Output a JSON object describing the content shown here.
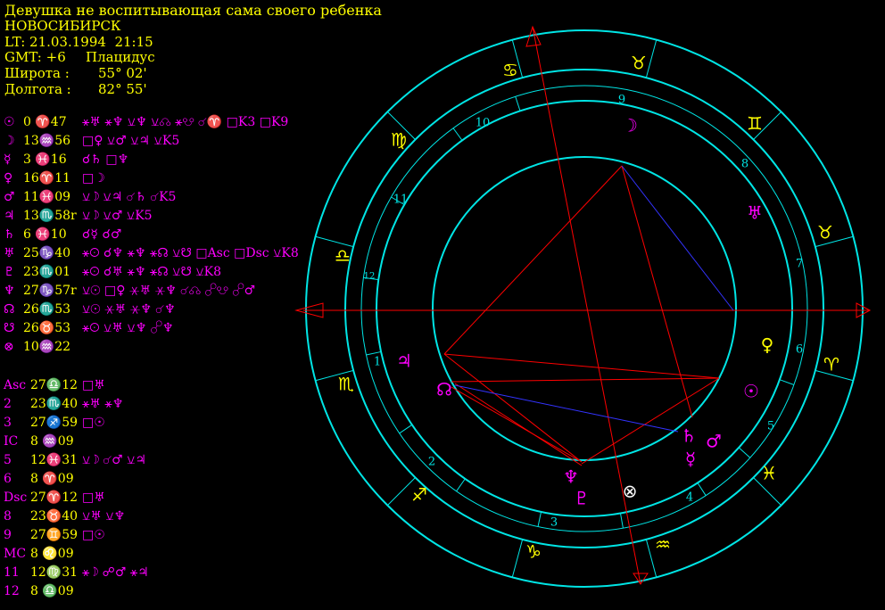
{
  "header": {
    "title": "Девушка не воспитывающая сама своего ребенка",
    "city": "НОВОСИБИРСК",
    "local_time": "LT: 21.03.1994  21:15",
    "gmt": "GMT: +6",
    "house_system": "Плацидус",
    "latitude_label": "Широта :",
    "latitude_value": "55° 02'",
    "longitude_label": "Долгота :",
    "longitude_value": "82° 55'"
  },
  "planets": [
    {
      "glyph": "☉",
      "pos": "0 ♈47",
      "aspects": "⚹♅ ⚹♆ ⚺♆ ⚺☊ ⚹☋ ☌♈ □K3 □K9"
    },
    {
      "glyph": "☽",
      "pos": "13♒56",
      "aspects": "□♀ ⚺♂ ⚺♃ ⚺K5"
    },
    {
      "glyph": "☿",
      "pos": "3 ♓16",
      "aspects": "☌♄ □♆"
    },
    {
      "glyph": "♀",
      "pos": "16♈11",
      "aspects": "□☽"
    },
    {
      "glyph": "♂",
      "pos": "11♓09",
      "aspects": "⚺☽ ⚺♃ ☌♄ ☌K5"
    },
    {
      "glyph": "♃",
      "pos": "13♏58r",
      "aspects": "⚺☽ ⚺♂ ⚺K5"
    },
    {
      "glyph": "♄",
      "pos": "6 ♓10",
      "aspects": "☌☿ ☌♂"
    },
    {
      "glyph": "♅",
      "pos": "25♑40",
      "aspects": "⚹☉ ☌♆ ⚹♆ ⚹☊ ⚺☋ □Asc □Dsc ⚺K8"
    },
    {
      "glyph": "♇",
      "pos": "23♏01",
      "aspects": "⚹☉ ☌♅ ⚹♆ ⚹☊ ⚺☋ ⚺K8"
    },
    {
      "glyph": "♆",
      "pos": "27♑57r",
      "aspects": "⚺☉ □♀ ⚹♅ ⚹♆ ☌☊ ☍☋ ☍♂"
    },
    {
      "glyph": "☊",
      "pos": "26♏53",
      "aspects": "⚺☉ ⚹♅ ⚹♆ ☌♆"
    },
    {
      "glyph": "☋",
      "pos": "26♉53",
      "aspects": "⚹☉ ⚺♅ ⚺♆ ☍♆"
    },
    {
      "glyph": "⊗",
      "pos": "10♒22",
      "aspects": ""
    }
  ],
  "houses": [
    {
      "label": "Asc",
      "pos": "27♎12",
      "aspects": "□♅"
    },
    {
      "label": "2",
      "pos": "23♏40",
      "aspects": "⚹♅ ⚹♆"
    },
    {
      "label": "3",
      "pos": "27♐59",
      "aspects": "□☉"
    },
    {
      "label": "IC",
      "pos": "8 ♒09",
      "aspects": ""
    },
    {
      "label": "5",
      "pos": "12♓31",
      "aspects": "⚺☽ ☌♂ ⚺♃"
    },
    {
      "label": "6",
      "pos": "8 ♈09",
      "aspects": ""
    },
    {
      "label": "Dsc",
      "pos": "27♈12",
      "aspects": "□♅"
    },
    {
      "label": "8",
      "pos": "23♉40",
      "aspects": "⚺♅ ⚺♆"
    },
    {
      "label": "9",
      "pos": "27♊59",
      "aspects": "□☉"
    },
    {
      "label": "MC",
      "pos": "8 ♌09",
      "aspects": ""
    },
    {
      "label": "11",
      "pos": "12♍31",
      "aspects": "⚹☽ ☍♂ ⚹♃"
    },
    {
      "label": "12",
      "pos": "8 ♎09",
      "aspects": ""
    }
  ],
  "wheel": {
    "signs": [
      {
        "glyph": "♋",
        "color": "#ffff00"
      },
      {
        "glyph": "♉",
        "color": "#ffff00"
      },
      {
        "glyph": "♊",
        "color": "#ffff00"
      },
      {
        "glyph": "♉",
        "color": "#ffff00"
      },
      {
        "glyph": "♈",
        "color": "#ffff00"
      },
      {
        "glyph": "♓",
        "color": "#ffff00"
      },
      {
        "glyph": "♒",
        "color": "#ffff00"
      },
      {
        "glyph": "♑",
        "color": "#ffff00"
      },
      {
        "glyph": "♐",
        "color": "#ffff00"
      },
      {
        "glyph": "♏",
        "color": "#ffff00"
      },
      {
        "glyph": "♎",
        "color": "#ffff00"
      },
      {
        "glyph": "♍",
        "color": "#ffff00"
      }
    ],
    "house_numbers": [
      "9",
      "10",
      "11",
      "12",
      "1",
      "2",
      "3",
      "4",
      "5",
      "6",
      "7",
      "8"
    ],
    "planets": [
      {
        "glyph": "☽",
        "color": "#ff00ff"
      },
      {
        "glyph": "♅",
        "color": "#ff00ff"
      },
      {
        "glyph": "♀",
        "color": "#ffff00"
      },
      {
        "glyph": "☉",
        "color": "#ff00ff"
      },
      {
        "glyph": "♂",
        "color": "#ff00ff"
      },
      {
        "glyph": "♄",
        "color": "#ff00ff"
      },
      {
        "glyph": "☿",
        "color": "#ff00ff"
      },
      {
        "glyph": "⊗",
        "color": "#ffffff"
      },
      {
        "glyph": "♆",
        "color": "#ff00ff"
      },
      {
        "glyph": "♇",
        "color": "#ff00ff"
      },
      {
        "glyph": "☊",
        "color": "#ff00ff"
      },
      {
        "glyph": "♃",
        "color": "#ff00ff"
      },
      {
        "glyph": "♎",
        "color": "#ffff00"
      }
    ],
    "colors": {
      "ring": "#00e5e5",
      "axis": "#ff0000",
      "aspect_red": "#ff0000",
      "aspect_blue": "#3333ff"
    }
  }
}
